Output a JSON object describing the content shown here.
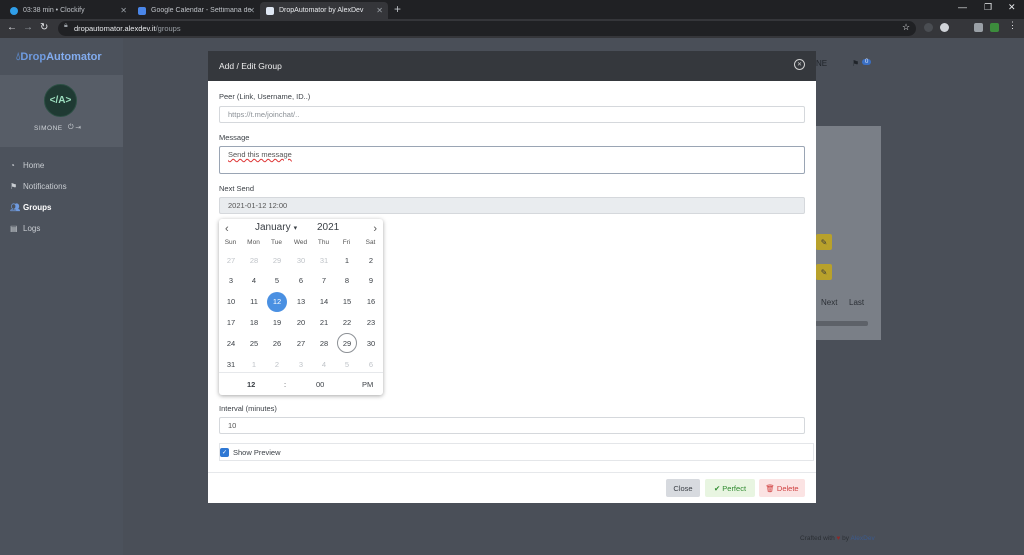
{
  "browser": {
    "tabs": [
      {
        "title": "03:38 min • Clockify",
        "active": false
      },
      {
        "title": "Google Calendar - Settimana del",
        "active": false
      },
      {
        "title": "DropAutomator by AlexDev",
        "active": true
      }
    ],
    "url_host": "dropautomator.alexdev.it",
    "url_path": "/groups"
  },
  "sidebar": {
    "brand_drop": "Drop",
    "brand_automator": "Automator",
    "avatar_text": "</A>",
    "username": "SIMONE",
    "items": [
      {
        "label": "Home",
        "icon": "home-icon"
      },
      {
        "label": "Notifications",
        "icon": "bell-icon"
      },
      {
        "label": "Groups",
        "icon": "users-icon"
      },
      {
        "label": "Logs",
        "icon": "list-icon"
      }
    ]
  },
  "background": {
    "header_user": "NE",
    "flag_count": "0",
    "next": "Next",
    "last": "Last",
    "crafted": "Crafted with",
    "by": "by",
    "author": "AlexDev"
  },
  "modal": {
    "title": "Add / Edit Group",
    "peer_label": "Peer (Link, Username, ID..)",
    "peer_placeholder": "https://t.me/joinchat/..",
    "message_label": "Message",
    "message_value": "Send this message",
    "next_send_label": "Next Send",
    "next_send_value": "2021-01-12 12:00",
    "interval_label": "Interval (minutes)",
    "interval_value": "10",
    "show_preview_label": "Show Preview",
    "show_preview_checked": true,
    "close_label": "Close",
    "perfect_label": "Perfect",
    "delete_label": "Delete"
  },
  "calendar": {
    "month": "January",
    "year": "2021",
    "weekdays": [
      "Sun",
      "Mon",
      "Tue",
      "Wed",
      "Thu",
      "Fri",
      "Sat"
    ],
    "weeks": [
      [
        "27",
        "28",
        "29",
        "30",
        "31",
        "1",
        "2"
      ],
      [
        "3",
        "4",
        "5",
        "6",
        "7",
        "8",
        "9"
      ],
      [
        "10",
        "11",
        "12",
        "13",
        "14",
        "15",
        "16"
      ],
      [
        "17",
        "18",
        "19",
        "20",
        "21",
        "22",
        "23"
      ],
      [
        "24",
        "25",
        "26",
        "27",
        "28",
        "29",
        "30"
      ],
      [
        "31",
        "1",
        "2",
        "3",
        "4",
        "5",
        "6"
      ]
    ],
    "selected": "12",
    "today": "29",
    "hour": "12",
    "separator": ":",
    "minute": "00",
    "ampm": "PM"
  },
  "colors": {
    "accent": "#4a90e2",
    "header": "#35383d",
    "success": "#2f8a2f",
    "danger": "#d04040"
  }
}
